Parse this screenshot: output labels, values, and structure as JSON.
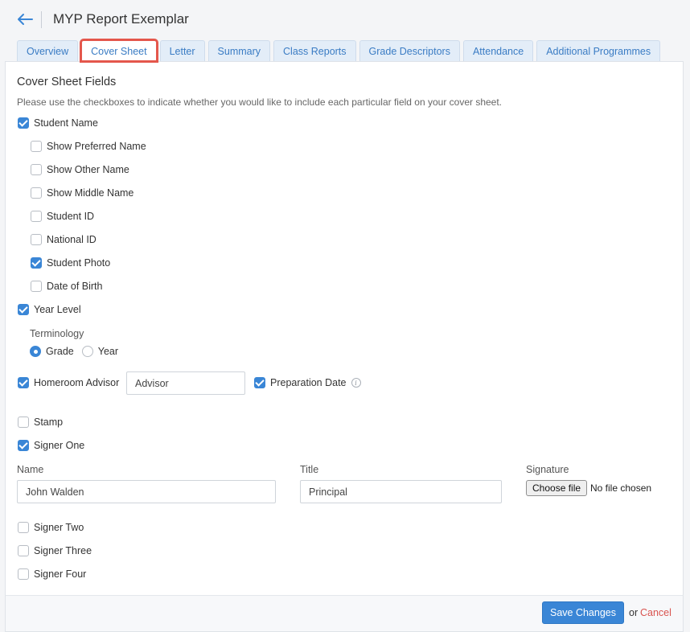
{
  "header": {
    "title": "MYP Report Exemplar"
  },
  "tabs": [
    {
      "label": "Overview"
    },
    {
      "label": "Cover Sheet"
    },
    {
      "label": "Letter"
    },
    {
      "label": "Summary"
    },
    {
      "label": "Class Reports"
    },
    {
      "label": "Grade Descriptors"
    },
    {
      "label": "Attendance"
    },
    {
      "label": "Additional Programmes"
    }
  ],
  "active_tab": "Cover Sheet",
  "section": {
    "title": "Cover Sheet Fields",
    "hint": "Please use the checkboxes to indicate whether you would like to include each particular field on your cover sheet."
  },
  "fields": {
    "student_name": {
      "label": "Student Name",
      "checked": true
    },
    "sub": [
      {
        "label": "Show Preferred Name",
        "checked": false
      },
      {
        "label": "Show Other Name",
        "checked": false
      },
      {
        "label": "Show Middle Name",
        "checked": false
      },
      {
        "label": "Student ID",
        "checked": false
      },
      {
        "label": "National ID",
        "checked": false
      },
      {
        "label": "Student Photo",
        "checked": true
      },
      {
        "label": "Date of Birth",
        "checked": false
      }
    ],
    "year_level": {
      "label": "Year Level",
      "checked": true
    },
    "terminology": {
      "label": "Terminology",
      "options": [
        {
          "label": "Grade",
          "selected": true
        },
        {
          "label": "Year",
          "selected": false
        }
      ]
    },
    "homeroom_advisor": {
      "label": "Homeroom Advisor",
      "checked": true,
      "input_value": "Advisor"
    },
    "preparation_date": {
      "label": "Preparation Date",
      "checked": true,
      "info_icon": "info-icon"
    },
    "stamp": {
      "label": "Stamp",
      "checked": false
    },
    "signer_one": {
      "label": "Signer One",
      "checked": true
    },
    "signer_fields": {
      "name_label": "Name",
      "name_value": "John Walden",
      "title_label": "Title",
      "title_value": "Principal",
      "signature_label": "Signature",
      "file_button": "Choose file",
      "file_status": "No file chosen"
    },
    "signers_other": [
      {
        "label": "Signer Two",
        "checked": false
      },
      {
        "label": "Signer Three",
        "checked": false
      },
      {
        "label": "Signer Four",
        "checked": false
      }
    ]
  },
  "footer": {
    "save_label": "Save Changes",
    "or_text": "or",
    "cancel_label": "Cancel"
  },
  "colors": {
    "accent": "#3a86d6",
    "tab_text": "#3a7cc4",
    "highlight": "#e4574c",
    "cancel": "#d9534f"
  }
}
